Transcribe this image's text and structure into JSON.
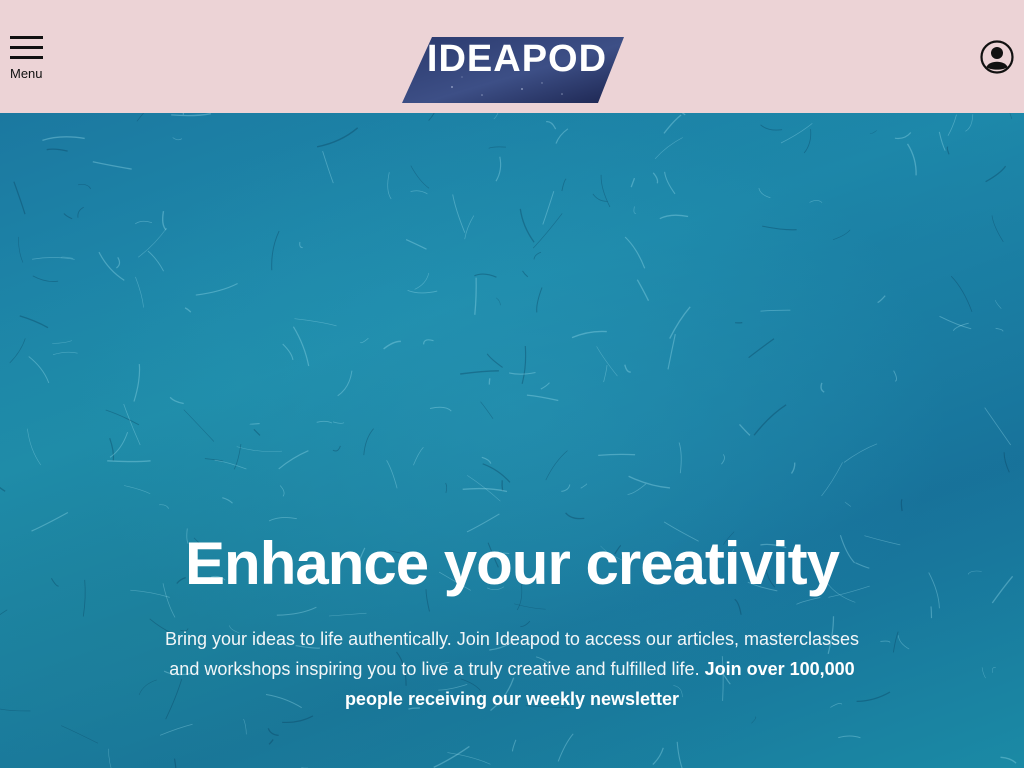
{
  "header": {
    "menu_label": "Menu",
    "logo_text": "IDEAPOD",
    "account_icon": "user-account-icon",
    "background": "#ecd3d6"
  },
  "hero": {
    "title": "Enhance your creativity",
    "description": "Bring your ideas to life authentically. Join Ideapod to access our articles, masterclasses and workshops inspiring you to live a truly creative and fulfilled life.",
    "cta_text": "Join over 100,000 people receiving our weekly newsletter",
    "background": "#1e8aa8"
  },
  "icons": {
    "menu": "hamburger-menu-icon",
    "account": "user-account-icon"
  }
}
